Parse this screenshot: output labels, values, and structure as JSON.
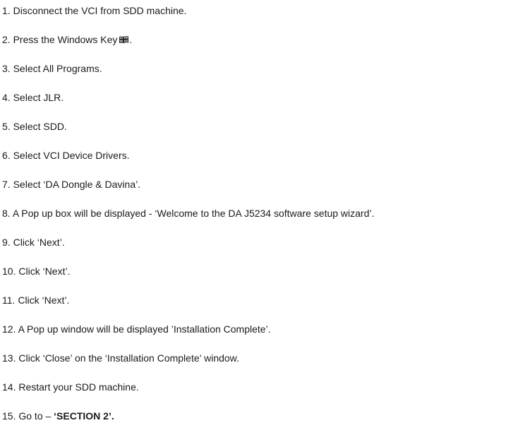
{
  "steps": [
    {
      "num": "1.",
      "text": "Disconnect the VCI from SDD machine."
    },
    {
      "num": "2.",
      "text": "Press the Windows Key",
      "icon": "windows-key-icon",
      "suffix": "."
    },
    {
      "num": "3.",
      "text": "Select All Programs."
    },
    {
      "num": "4.",
      "text": "Select JLR."
    },
    {
      "num": "5.",
      "text": "Select SDD."
    },
    {
      "num": "6.",
      "text": "Select VCI Device Drivers."
    },
    {
      "num": "7.",
      "text": "Select ‘DA Dongle & Davina’."
    },
    {
      "num": "8.",
      "text": "A Pop up box will be displayed - ‘Welcome to the DA J5234 software setup wizard’."
    },
    {
      "num": "9.",
      "text": "Click ‘Next’."
    },
    {
      "num": "10.",
      "text": "Click ‘Next’."
    },
    {
      "num": "11.",
      "text": "Click ‘Next’."
    },
    {
      "num": "12.",
      "text": "A Pop up window will be displayed ’Installation Complete’."
    },
    {
      "num": "13.",
      "text": "Click ‘Close’ on the ‘Installation Complete’ window."
    },
    {
      "num": "14.",
      "text": "Restart your SDD machine."
    },
    {
      "num": "15.",
      "text": "Go to –",
      "bold_text": "‘SECTION 2’."
    }
  ]
}
